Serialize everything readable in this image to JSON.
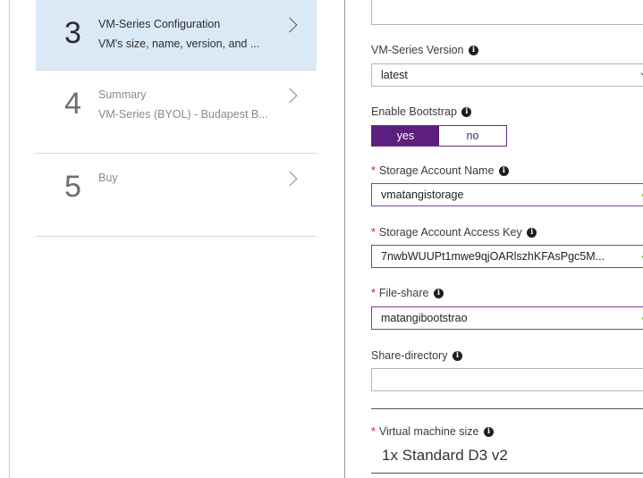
{
  "steps": [
    {
      "number": "3",
      "title": "VM-Series Configuration",
      "subtitle": "VM's size, name, version, and ..."
    },
    {
      "number": "4",
      "title": "Summary",
      "subtitle": "VM-Series (BYOL) - Budapest B..."
    },
    {
      "number": "5",
      "title": "Buy",
      "subtitle": ""
    }
  ],
  "form": {
    "vm_series_version": {
      "label": "VM-Series Version",
      "value": "latest"
    },
    "enable_bootstrap": {
      "label": "Enable Bootstrap",
      "yes": "yes",
      "no": "no",
      "selected": "yes"
    },
    "storage_account_name": {
      "required": "*",
      "label": "Storage Account Name",
      "value": "vmatangistorage"
    },
    "storage_account_access_key": {
      "required": "*",
      "label": "Storage Account Access Key",
      "value": "7nwbWUUPt1mwe9qjOARlszhKFAsPgc5M..."
    },
    "file_share": {
      "required": "*",
      "label": "File-share",
      "value": "matangibootstrao"
    },
    "share_directory": {
      "label": "Share-directory",
      "value": ""
    },
    "virtual_machine_size": {
      "required": "*",
      "label": "Virtual machine size",
      "value": "1x Standard D3 v2"
    }
  },
  "icons": {
    "info": "info-icon",
    "chevron": "chevron-right-icon",
    "check": "checkmark-icon",
    "dropdown": "chevron-down-icon"
  },
  "colors": {
    "active_step_bg": "#dbe9f7",
    "toggle_on": "#5c1f7e",
    "valid_border": "#7a3e9d",
    "check": "#7cb900",
    "required": "#e81123"
  }
}
